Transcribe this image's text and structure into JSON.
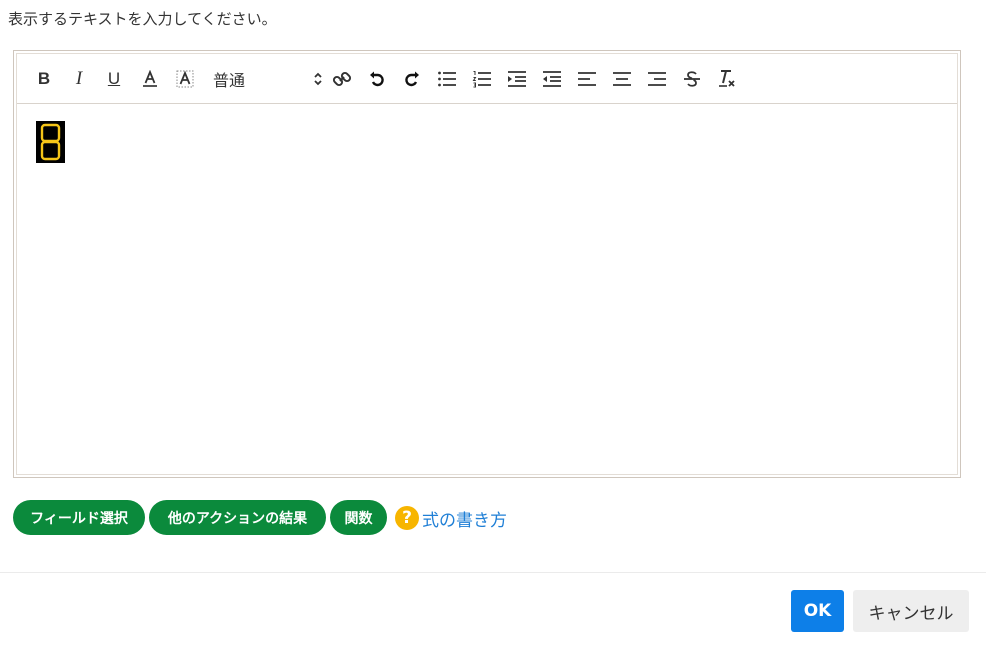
{
  "instruction": "表示するテキストを入力してください。",
  "toolbar": {
    "bold_label": "B",
    "italic_label": "I",
    "underline_label": "U",
    "font_size_value": "普通",
    "icons": [
      "bold-icon",
      "italic-icon",
      "underline-icon",
      "font-color-icon",
      "background-color-icon",
      "link-icon",
      "undo-icon",
      "redo-icon",
      "bullet-list-icon",
      "numbered-list-icon",
      "indent-icon",
      "outdent-icon",
      "align-left-icon",
      "align-center-icon",
      "align-right-icon",
      "strikethrough-icon",
      "clear-format-icon"
    ]
  },
  "content": {
    "digit_color": "#f5c518",
    "digit_background": "#000000"
  },
  "chips": {
    "field_select": "フィールド選択",
    "other_action_result": "他のアクションの結果",
    "functions": "関数"
  },
  "help": {
    "icon": "?",
    "label": "式の書き方"
  },
  "buttons": {
    "ok": "OK",
    "cancel": "キャンセル"
  },
  "colors": {
    "chip_green": "#0b8a3c",
    "ok_blue": "#0d7fe8",
    "help_yellow": "#f7b500",
    "link_blue": "#1f7fd6"
  }
}
